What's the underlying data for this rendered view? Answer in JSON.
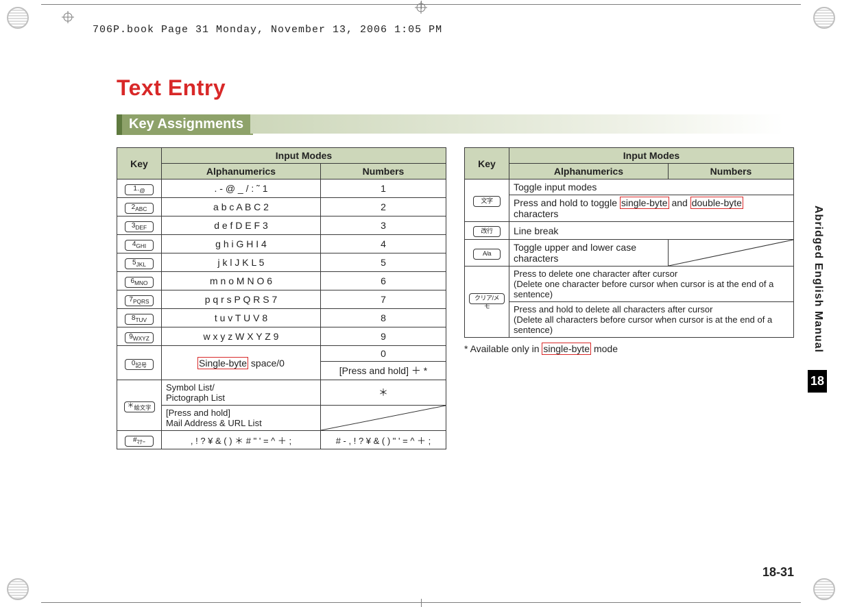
{
  "filepath_header": "706P.book  Page 31  Monday, November 13, 2006  1:05 PM",
  "title": "Text Entry",
  "section": "Key Assignments",
  "side_tab": "Abridged English Manual",
  "chapter": "18",
  "page_num": "18-31",
  "left_table": {
    "head_key": "Key",
    "head_input": "Input Modes",
    "head_alpha": "Alphanumerics",
    "head_num": "Numbers",
    "rows": [
      {
        "key": "1",
        "alpha": ". - @ _ / : ˜ 1",
        "num": "1"
      },
      {
        "key": "2",
        "alpha": "a b c A B C 2",
        "num": "2"
      },
      {
        "key": "3",
        "alpha": "d e f D E F 3",
        "num": "3"
      },
      {
        "key": "4",
        "alpha": "g h i G H I 4",
        "num": "4"
      },
      {
        "key": "5",
        "alpha": "j k l J K L 5",
        "num": "5"
      },
      {
        "key": "6",
        "alpha": "m n o M N O 6",
        "num": "6"
      },
      {
        "key": "7",
        "alpha": "p q r s P Q R S 7",
        "num": "7"
      },
      {
        "key": "8",
        "alpha": "t u v T U V 8",
        "num": "8"
      },
      {
        "key": "9",
        "alpha": "w x y z W X Y Z 9",
        "num": "9"
      }
    ],
    "row0_key": "0",
    "row0_alpha_pre": "Single-byte",
    "row0_alpha_post": " space/0",
    "row0_num_top": "0",
    "row0_num_bot": "[Press and hold] ＋ *",
    "star_key": "＊",
    "star_alpha_top": "Symbol List/\nPictograph List",
    "star_num_top": "＊",
    "star_alpha_bot": "[Press and hold]\nMail Address & URL List",
    "hash_key": "#",
    "hash_alpha": ", ! ? ¥ & ( ) ＊ # \" ' = ^ ＋ ;",
    "hash_num": "# - , ! ? ¥ & ( ) \" ' = ^ ＋ ;"
  },
  "right_table": {
    "head_key": "Key",
    "head_input": "Input Modes",
    "head_alpha": "Alphanumerics",
    "head_num": "Numbers",
    "r1_line1": "Toggle input modes",
    "r1_line2_pre": "Press and hold to toggle ",
    "r1_line2_hl1": "single-byte",
    "r1_line2_mid": " and ",
    "r1_line2_hl2": "double-byte",
    "r1_line2_post": " characters",
    "r1_key": "文字",
    "r2_text": "Line break",
    "r2_key": "改行",
    "r3_alpha": "Toggle upper and lower case characters",
    "r3_key": "A/a",
    "r4_top": "Press to delete one character after cursor\n(Delete one character before cursor when cursor is at the end of a sentence)",
    "r4_bot": "Press and hold to delete all characters after cursor\n(Delete all characters before cursor when cursor is at the end of a sentence)",
    "r4_key": "クリア/メモ"
  },
  "footnote_pre": "*   Available only in ",
  "footnote_hl": "single-byte",
  "footnote_post": " mode"
}
